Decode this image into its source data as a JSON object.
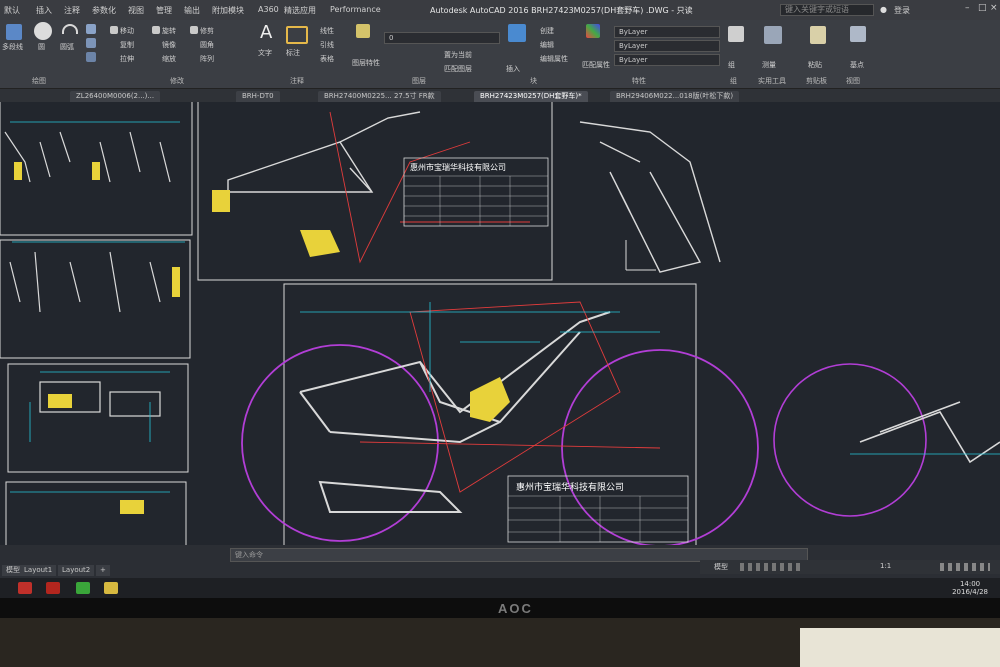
{
  "titlebar": {
    "menus": [
      "默认",
      "插入",
      "注释",
      "参数化",
      "视图",
      "管理",
      "输出",
      "附加模块",
      "A360",
      "精选应用",
      "Performance"
    ],
    "title": "Autodesk AutoCAD 2016    BRH27423M0257(DH套野车) .DWG - 只读",
    "search_placeholder": "键入关键字或短语",
    "login": "登录"
  },
  "ribbon": {
    "groups": [
      "绘图",
      "修改",
      "注释",
      "图层",
      "块",
      "特性",
      "组",
      "实用工具",
      "剪贴板",
      "视图"
    ],
    "labels": {
      "multiline": "多段线",
      "circle": "圆",
      "arc": "圆弧",
      "move": "移动",
      "rotate": "旋转",
      "trim": "修剪",
      "copy": "复制",
      "mirror": "镜像",
      "fillet": "圆角",
      "stretch": "拉伸",
      "scale": "缩放",
      "array": "阵列",
      "text": "文字",
      "dimension": "标注",
      "linear": "线性",
      "leader": "引线",
      "table": "表格",
      "layer_props": "图层特性",
      "insert": "插入",
      "create": "创建",
      "edit": "编辑",
      "edit_attr": "编辑属性",
      "match_props": "匹配属性",
      "group": "组",
      "measure": "测量",
      "paste": "粘贴",
      "base": "基点",
      "current_layer": "0",
      "bylayer1": "ByLayer",
      "bylayer2": "ByLayer",
      "bylayer3": "ByLayer",
      "set_current": "置为当前",
      "match_layer": "匹配图层"
    }
  },
  "doc_tabs": [
    {
      "label": "ZL26400M0006(2...)...",
      "active": false
    },
    {
      "label": "BRH-DT0",
      "active": false
    },
    {
      "label": "BRH27400M0225... 27.5寸 FR款",
      "active": false
    },
    {
      "label": "BRH27423M0257(DH套野车)*",
      "active": true
    },
    {
      "label": "BRH29406M022...018版(叶松下款)",
      "active": false
    }
  ],
  "title_blocks": {
    "company_top": "惠州市宝瑞华科技有限公司",
    "company_bottom": "惠州市宝瑞华科技有限公司"
  },
  "command": {
    "placeholder": "键入命令"
  },
  "layout_tabs": [
    "模型",
    "Layout1",
    "Layout2"
  ],
  "status": {
    "model": "模型",
    "scale": "1:1"
  },
  "clock": {
    "time": "14:00",
    "date": "2016/4/28"
  },
  "monitor_brand": "AOC",
  "colors": {
    "canvas_bg": "#22262d",
    "purple_wheel": "#b23ed6",
    "yellow_part": "#e8d23a",
    "cyan_dim": "#26c6da",
    "red_line": "#e23c3c",
    "frame_white": "#d9d9d9"
  }
}
